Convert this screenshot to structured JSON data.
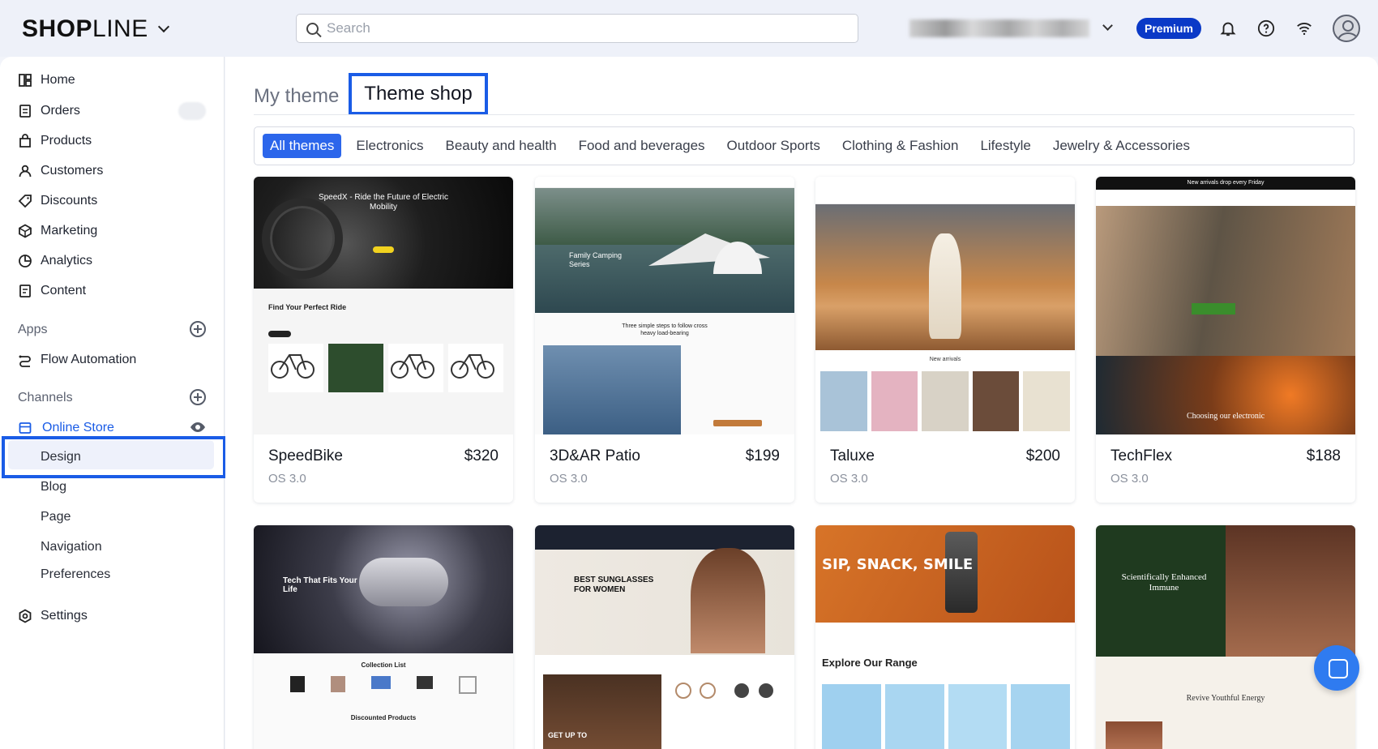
{
  "header": {
    "logo_bold": "SHOP",
    "logo_light": "LINE",
    "search_placeholder": "Search",
    "plan_badge": "Premium"
  },
  "sidebar": {
    "items": [
      {
        "label": "Home",
        "icon": "home-icon"
      },
      {
        "label": "Orders",
        "icon": "orders-icon"
      },
      {
        "label": "Products",
        "icon": "products-icon"
      },
      {
        "label": "Customers",
        "icon": "customers-icon"
      },
      {
        "label": "Discounts",
        "icon": "discounts-icon"
      },
      {
        "label": "Marketing",
        "icon": "marketing-icon"
      },
      {
        "label": "Analytics",
        "icon": "analytics-icon"
      },
      {
        "label": "Content",
        "icon": "content-icon"
      }
    ],
    "apps_label": "Apps",
    "apps_items": [
      {
        "label": "Flow Automation",
        "icon": "flow-icon"
      }
    ],
    "channels_label": "Channels",
    "online_store": "Online Store",
    "store_sub": [
      "Design",
      "Blog",
      "Page",
      "Navigation",
      "Preferences"
    ],
    "settings": "Settings"
  },
  "main": {
    "tabs": [
      {
        "label": "My theme"
      },
      {
        "label": "Theme shop",
        "active": true
      }
    ],
    "categories": [
      "All themes",
      "Electronics",
      "Beauty and health",
      "Food and beverages",
      "Outdoor Sports",
      "Clothing & Fashion",
      "Lifestyle",
      "Jewelry & Accessories"
    ],
    "themes": [
      {
        "name": "SpeedBike",
        "price": "$320",
        "os": "OS 3.0"
      },
      {
        "name": "3D&AR Patio",
        "price": "$199",
        "os": "OS 3.0"
      },
      {
        "name": "Taluxe",
        "price": "$200",
        "os": "OS 3.0"
      },
      {
        "name": "TechFlex",
        "price": "$188",
        "os": "OS 3.0"
      }
    ],
    "previews": {
      "speedbike_hero": "SpeedX - Ride the Future of Electric Mobility",
      "speedbike_section": "Find Your Perfect Ride",
      "patio_hero": "Family Camping Series",
      "patio_sub": "Three simple steps to follow cross heavy load-bearing",
      "taluxe_section": "New arrivals",
      "techflex_banner": "New arrivals drop every Friday",
      "techflex_sub": "Choosing our electronic",
      "row2_a_hero": "Tech That Fits Your Life",
      "row2_a_section": "Collection List",
      "row2_a_section2": "Discounted Products",
      "row2_b_hero": "BEST SUNGLASSES FOR WOMEN",
      "row2_b_sub": "GET UP TO",
      "row2_c_hero": "SIP, SNACK, SMILE",
      "row2_c_section": "Explore Our Range",
      "row2_d_hero": "Scientifically Enhanced Immune",
      "row2_d_section": "Revive Youthful Energy"
    }
  },
  "colors": {
    "accent": "#1a5ce6",
    "premium": "#0a39c7",
    "active_chip": "#2c66eb"
  }
}
